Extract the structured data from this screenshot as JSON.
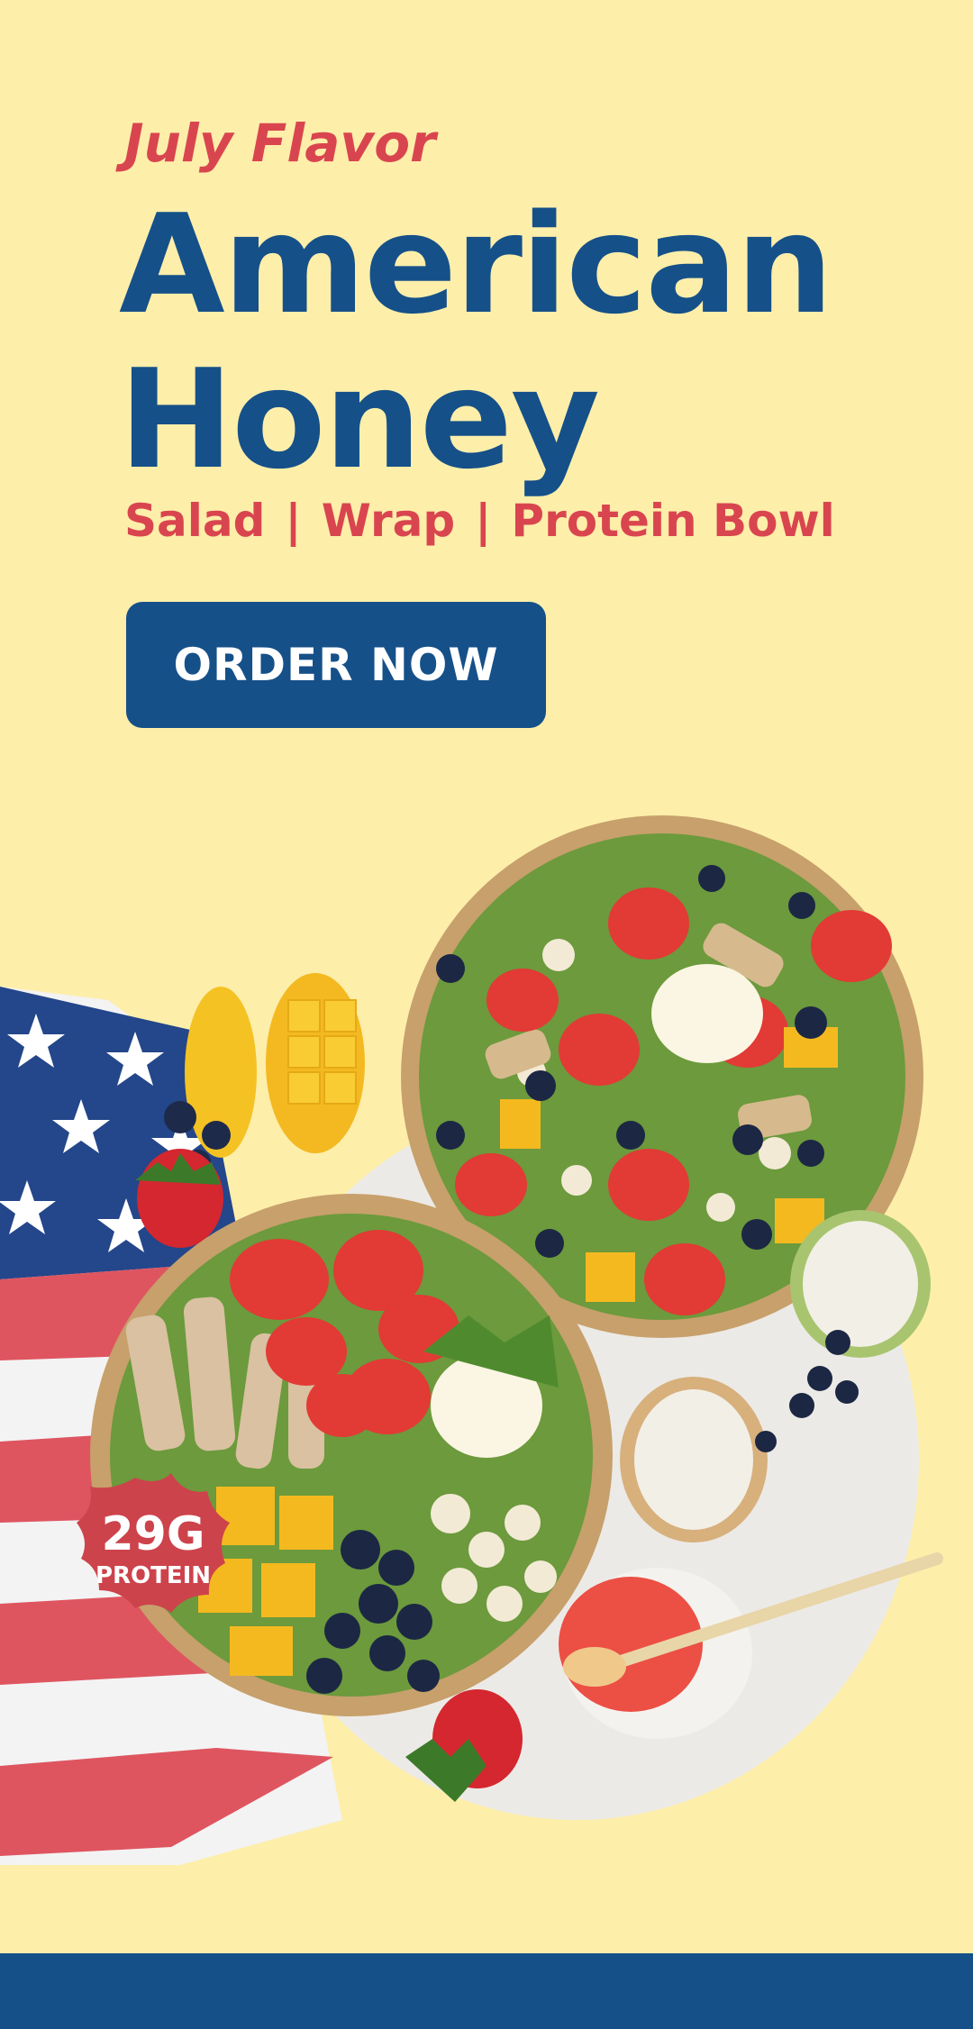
{
  "promo": {
    "eyebrow": "July Flavor",
    "title_line1": "American",
    "title_line2": "Honey",
    "menu_items": [
      "Salad",
      "Wrap",
      "Protein Bowl"
    ],
    "menu_separator": "|",
    "cta_label": "ORDER NOW"
  },
  "badge": {
    "value": "29G",
    "label": "PROTEIN"
  },
  "colors": {
    "background": "#fdeeaa",
    "brand_blue": "#155089",
    "accent_red": "#d9454f"
  }
}
